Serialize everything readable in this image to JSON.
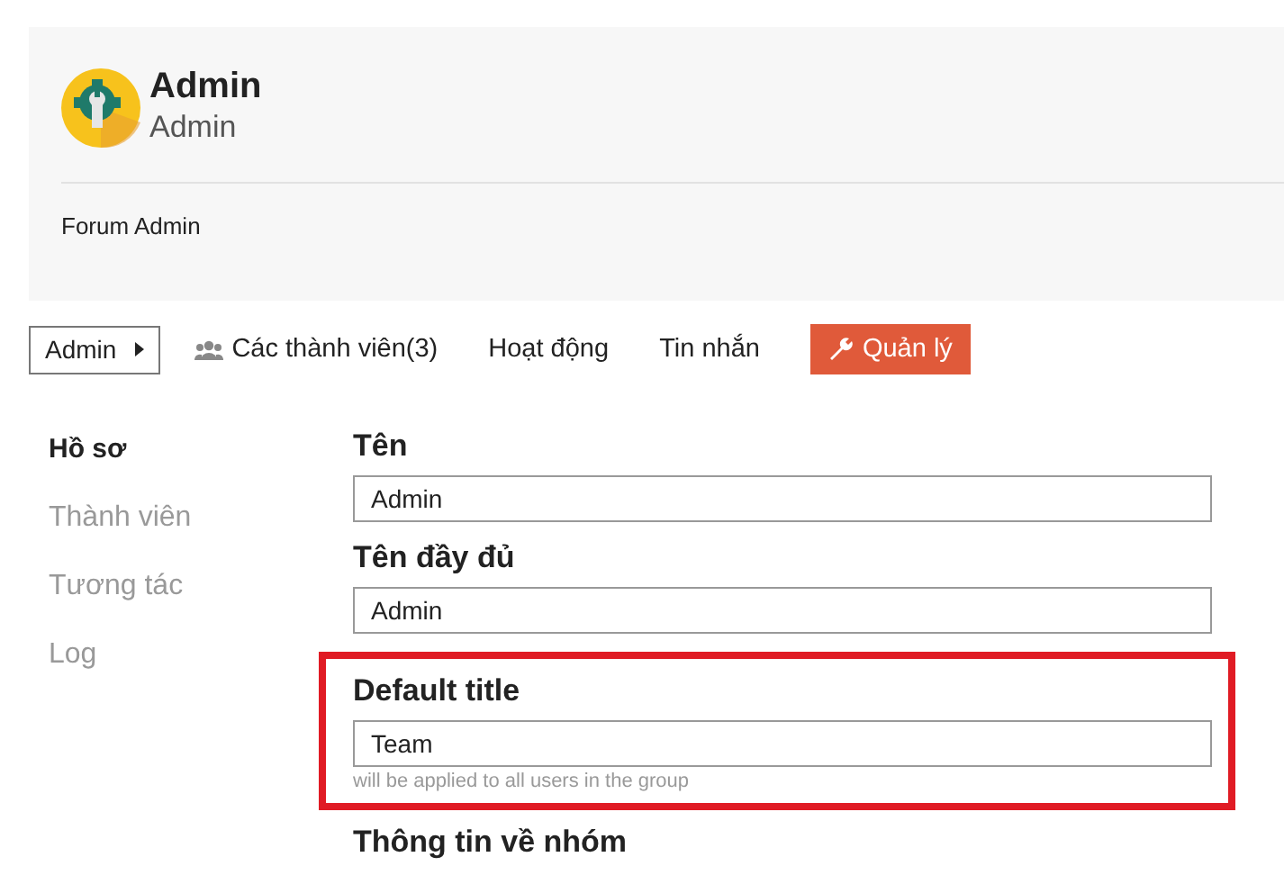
{
  "header": {
    "title": "Admin",
    "subtitle": "Admin",
    "description": "Forum Admin"
  },
  "nav": [
    {
      "kind": "dropdown",
      "label": "Admin"
    },
    {
      "kind": "members",
      "label": "Các thành viên(3)"
    },
    {
      "kind": "link",
      "label": "Hoạt động"
    },
    {
      "kind": "link",
      "label": "Tin nhắn"
    },
    {
      "kind": "manage",
      "label": "Quản lý"
    }
  ],
  "sidebar": {
    "items": [
      {
        "label": "Hồ sơ",
        "selected": true
      },
      {
        "label": "Thành viên",
        "selected": false
      },
      {
        "label": "Tương tác",
        "selected": false
      },
      {
        "label": "Log",
        "selected": false
      }
    ]
  },
  "form": {
    "fields": [
      {
        "label": "Tên",
        "value": "Admin",
        "highlighted": false
      },
      {
        "label": "Tên đầy đủ",
        "value": "Admin",
        "highlighted": false
      },
      {
        "label": "Default title",
        "value": "Team",
        "hint": "will be applied to all users in the group",
        "highlighted": true
      }
    ],
    "next_section": "Thông tin về nhóm"
  }
}
